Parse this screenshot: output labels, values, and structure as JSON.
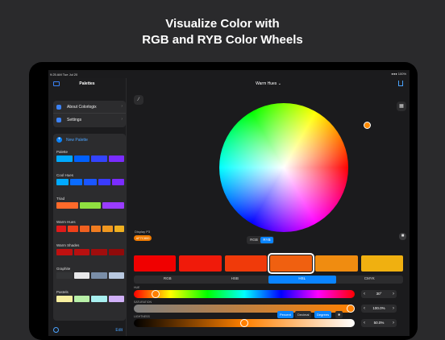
{
  "headline": [
    "Visualize Color with",
    "RGB and RYB Color Wheels"
  ],
  "status": {
    "time": "9:25 AM  Tue Jul 20",
    "system": "●●● 100%"
  },
  "sidebar": {
    "title": "Palettes",
    "menu": [
      {
        "label": "About Colorlogix",
        "icon": "info-icon"
      },
      {
        "label": "Settings",
        "icon": "gear-icon"
      }
    ],
    "new_palette": "New Palette",
    "palettes": [
      {
        "name": "Palette",
        "colors": [
          "#00aaff",
          "#0060ff",
          "#3344ff",
          "#7a2cff"
        ]
      },
      {
        "name": "Cool Hues",
        "colors": [
          "#00aaff",
          "#0a6cff",
          "#1a56ff",
          "#3a3bff",
          "#7a2cff"
        ]
      },
      {
        "name": "Triad",
        "colors": [
          "#ff6a2a",
          "#8fe040",
          "#9a3cff"
        ]
      },
      {
        "name": "Warm Hues",
        "colors": [
          "#e01a1a",
          "#f0401a",
          "#f06020",
          "#f07c20",
          "#f09820",
          "#f0b020"
        ]
      },
      {
        "name": "Warm Shades",
        "colors": [
          "#c01010",
          "#b81010",
          "#a00d0d",
          "#900a0a"
        ]
      },
      {
        "name": "Graphite",
        "colors": [
          "#333436",
          "#e8e8ea",
          "#7a8ea8",
          "#b8c8e0"
        ]
      },
      {
        "name": "Pastels",
        "colors": [
          "#f8f0a0",
          "#b8f0a8",
          "#a8f0f0",
          "#d0b0f8"
        ]
      }
    ],
    "edit_label": "Edit"
  },
  "main": {
    "title": "Warm Hues ⌄",
    "display_p3": "Display P3",
    "hex": "#F7C800",
    "wheel_modes": [
      "RGB",
      "RYB"
    ],
    "wheel_mode_active": 1,
    "shades": [
      "#f00000",
      "#f01a0a",
      "#f03a0a",
      "#f06010",
      "#f08c10",
      "#f0b010"
    ],
    "shade_selected": 3,
    "models": [
      "RGB",
      "HSB",
      "HSL",
      "CMYK"
    ],
    "model_active": 2,
    "sliders": [
      {
        "label": "HUE",
        "value": "30°",
        "level": 0.083
      },
      {
        "label": "SATURATION",
        "value": "100.0%",
        "level": 1.0
      },
      {
        "label": "LIGHTNESS",
        "value": "50.0%",
        "level": 0.5
      }
    ],
    "formats": [
      "Percent",
      "Decimal",
      "Degrees"
    ],
    "formats_active": [
      0,
      2
    ]
  }
}
